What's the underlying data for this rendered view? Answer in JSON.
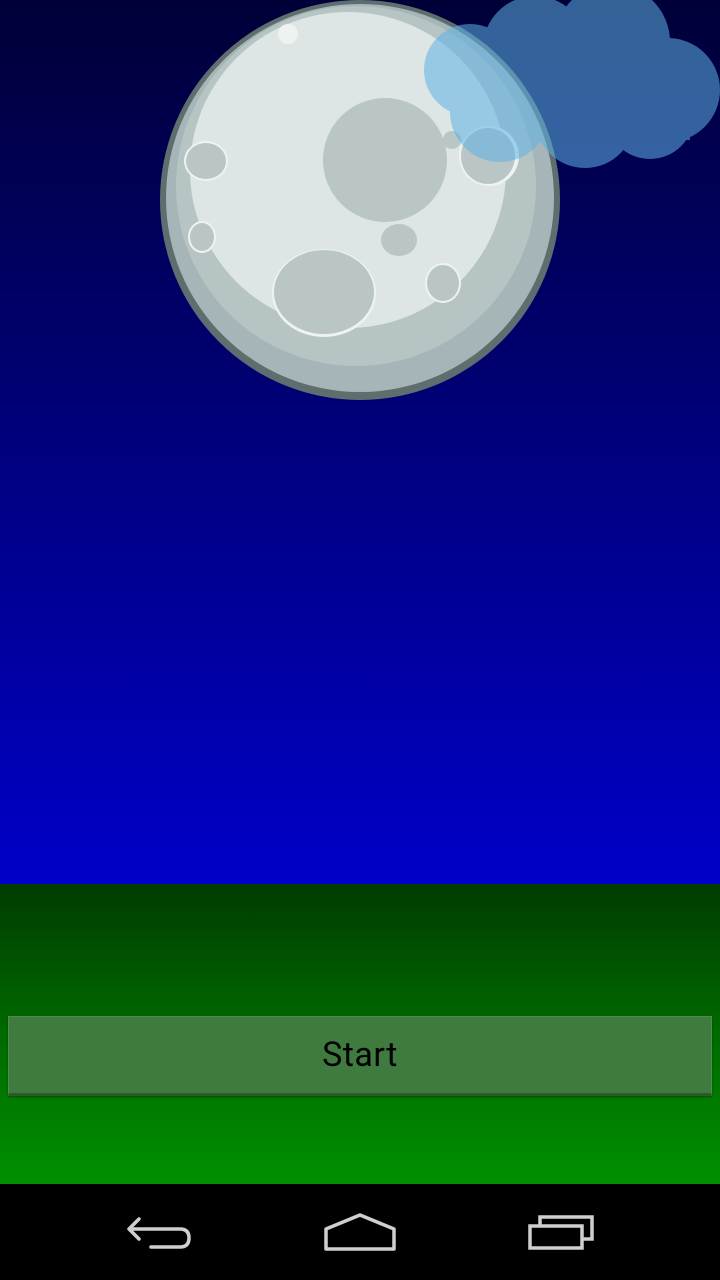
{
  "main": {
    "start_label": "Start"
  },
  "scene": {
    "moon_icon": "moon-icon",
    "cloud_icon": "cloud-icon"
  },
  "nav": {
    "back_icon": "back-icon",
    "home_icon": "home-icon",
    "recents_icon": "recents-icon"
  },
  "colors": {
    "sky_top": "#000038",
    "sky_bottom": "#0000c8",
    "ground_top": "#003c00",
    "ground_bottom": "#009000",
    "button": "#3f7b3f",
    "moon": "#dde6e4",
    "cloud": "#5fb2e6"
  }
}
